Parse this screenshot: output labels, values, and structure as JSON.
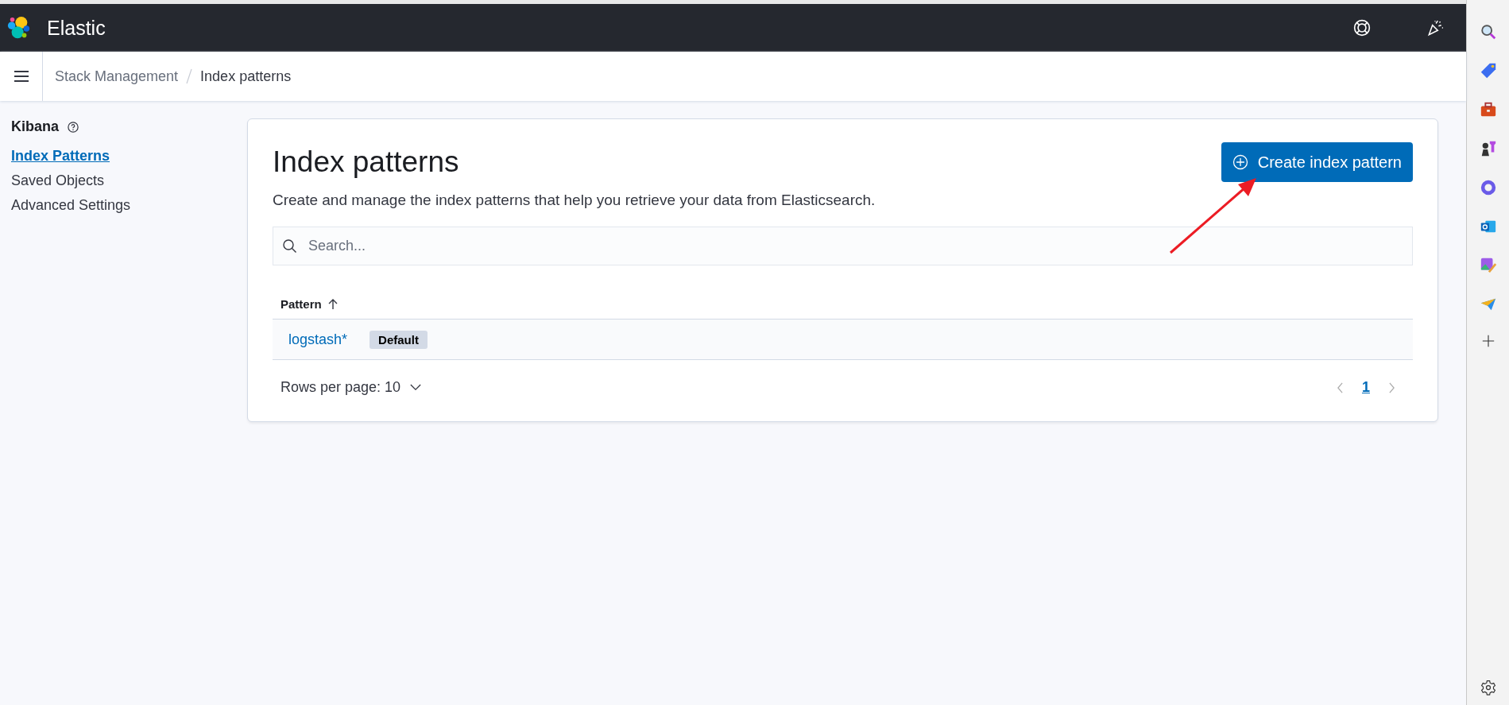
{
  "app_header": {
    "title": "Elastic"
  },
  "breadcrumbs": [
    {
      "label": "Stack Management",
      "selected": false
    },
    {
      "label": "Index patterns",
      "selected": true
    }
  ],
  "sidebar": {
    "title": "Kibana",
    "items": [
      {
        "label": "Index Patterns",
        "selected": true
      },
      {
        "label": "Saved Objects",
        "selected": false
      },
      {
        "label": "Advanced Settings",
        "selected": false
      }
    ]
  },
  "page": {
    "title": "Index patterns",
    "description": "Create and manage the index patterns that help you retrieve your data from Elasticsearch.",
    "create_button": "Create index pattern",
    "search": {
      "placeholder": "Search..."
    },
    "table": {
      "columns": [
        "Pattern"
      ],
      "rows": [
        {
          "pattern": "logstash*",
          "badge": "Default"
        }
      ]
    },
    "rows_per_page": "Rows per page: 10",
    "pagination": [
      {
        "label": "1",
        "selected": true
      }
    ]
  }
}
